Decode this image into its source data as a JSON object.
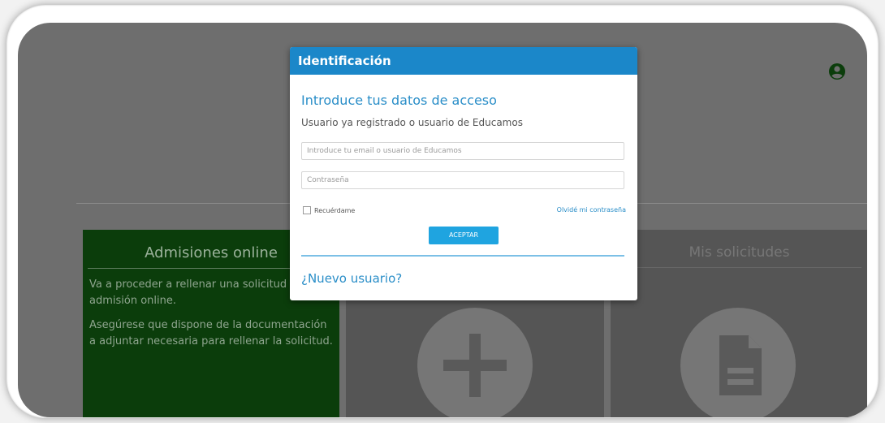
{
  "page": {
    "background_color": "#6e6e6e"
  },
  "panels": {
    "admissions": {
      "title": "Admisiones online",
      "paragraph1": "Va a proceder a rellenar una solicitud de admisión online.",
      "paragraph2": "Asegúrese que dispone de la documentación a adjuntar necesaria para rellenar la solicitud."
    },
    "new_request": {
      "icon": "plus-icon"
    },
    "my_requests": {
      "title": "Mis solicitudes",
      "icon": "document-icon"
    }
  },
  "login_dialog": {
    "header": "Identificación",
    "title": "Introduce tus datos de acceso",
    "subtitle": "Usuario ya registrado o usuario de Educamos",
    "user_placeholder": "Introduce tu email o usuario de Educamos",
    "password_placeholder": "Contraseña",
    "remember_label": "Recuérdame",
    "forgot_label": "Olvidé mi contraseña",
    "accept_label": "ACEPTAR",
    "new_user_label": "¿Nuevo usuario?",
    "accent_color": "#1b87c9"
  },
  "header": {
    "account_icon": "account-circle-icon"
  }
}
